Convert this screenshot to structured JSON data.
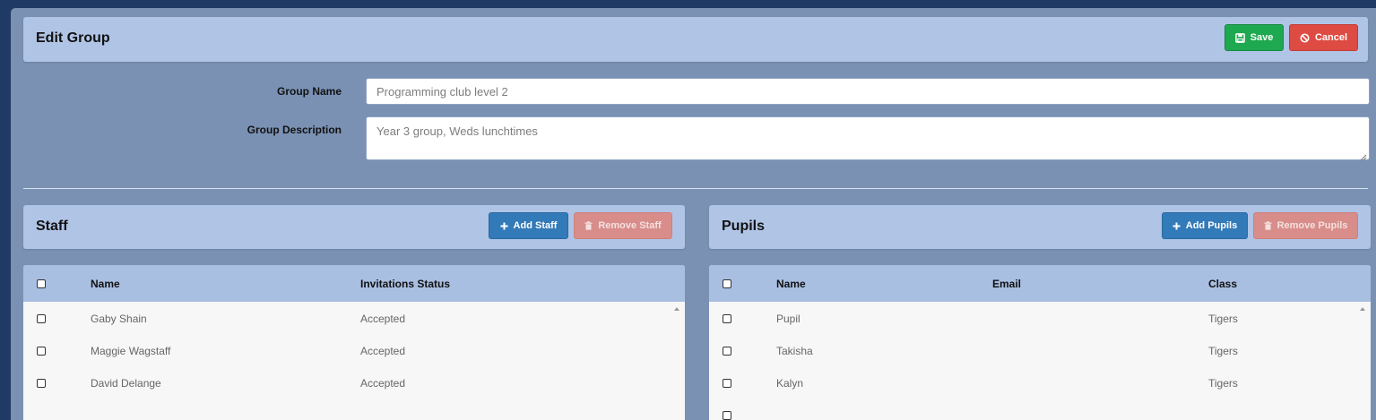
{
  "header": {
    "title": "Edit Group",
    "save_label": "Save",
    "cancel_label": "Cancel"
  },
  "form": {
    "group_name_label": "Group Name",
    "group_name_value": "Programming club level 2",
    "group_description_label": "Group Description",
    "group_description_value": "Year 3 group, Weds lunchtimes"
  },
  "staff": {
    "title": "Staff",
    "add_label": "Add Staff",
    "remove_label": "Remove Staff",
    "columns": [
      "Name",
      "Invitations Status"
    ],
    "rows": [
      {
        "name": "Gaby Shain",
        "status": "Accepted"
      },
      {
        "name": "Maggie Wagstaff",
        "status": "Accepted"
      },
      {
        "name": "David Delange",
        "status": "Accepted"
      }
    ]
  },
  "pupils": {
    "title": "Pupils",
    "add_label": "Add Pupils",
    "remove_label": "Remove Pupils",
    "columns": [
      "Name",
      "Email",
      "Class"
    ],
    "rows": [
      {
        "name": "Pupil",
        "email": "",
        "class": "Tigers"
      },
      {
        "name": "Takisha",
        "email": "",
        "class": "Tigers"
      },
      {
        "name": "Kalyn",
        "email": "",
        "class": "Tigers"
      }
    ]
  },
  "colors": {
    "page_bg": "#7a91b4",
    "panel_header": "#b0c4e6",
    "save_green": "#1ea84f",
    "cancel_red": "#de4b43",
    "primary_blue": "#327ab8",
    "disabled_red": "#d88d8a"
  },
  "icons": {
    "save": "floppy-disk-icon",
    "cancel": "ban-icon",
    "add": "plus-icon",
    "remove": "trash-icon"
  }
}
